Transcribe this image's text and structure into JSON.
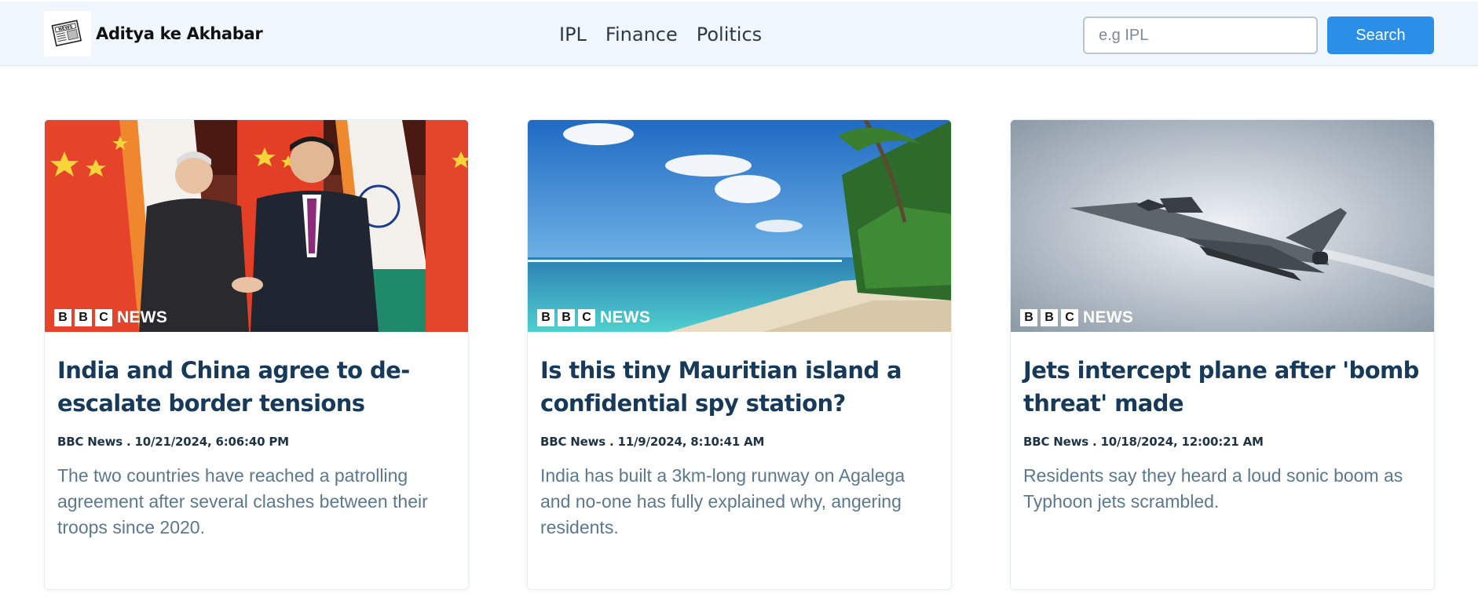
{
  "header": {
    "brand": "Aditya ke Akhabar",
    "logo_text": "NEWS",
    "nav_links": [
      "IPL",
      "Finance",
      "Politics"
    ],
    "search": {
      "placeholder": "e.g IPL",
      "value": "",
      "button_label": "Search"
    }
  },
  "badge": {
    "letters": [
      "B",
      "B",
      "C"
    ],
    "word": "NEWS"
  },
  "articles": [
    {
      "title": "India and China agree to de-escalate border tensions",
      "meta": "BBC News . 10/21/2024, 6:06:40 PM",
      "description": "The two countries have reached a patrolling agreement after several clashes between their troops since 2020."
    },
    {
      "title": "Is this tiny Mauritian island a confidential spy station?",
      "meta": "BBC News . 11/9/2024, 8:10:41 AM",
      "description": "India has built a 3km-long runway on Agalega and no-one has fully explained why, angering residents."
    },
    {
      "title": "Jets intercept plane after 'bomb threat' made",
      "meta": "BBC News . 10/18/2024, 12:00:21 AM",
      "description": "Residents say they heard a loud sonic boom as Typhoon jets scrambled."
    }
  ],
  "colors": {
    "accent": "#2b8fe8",
    "nav_bg": "#f0f7fe",
    "title": "#173a5a",
    "description": "#5a7890"
  }
}
